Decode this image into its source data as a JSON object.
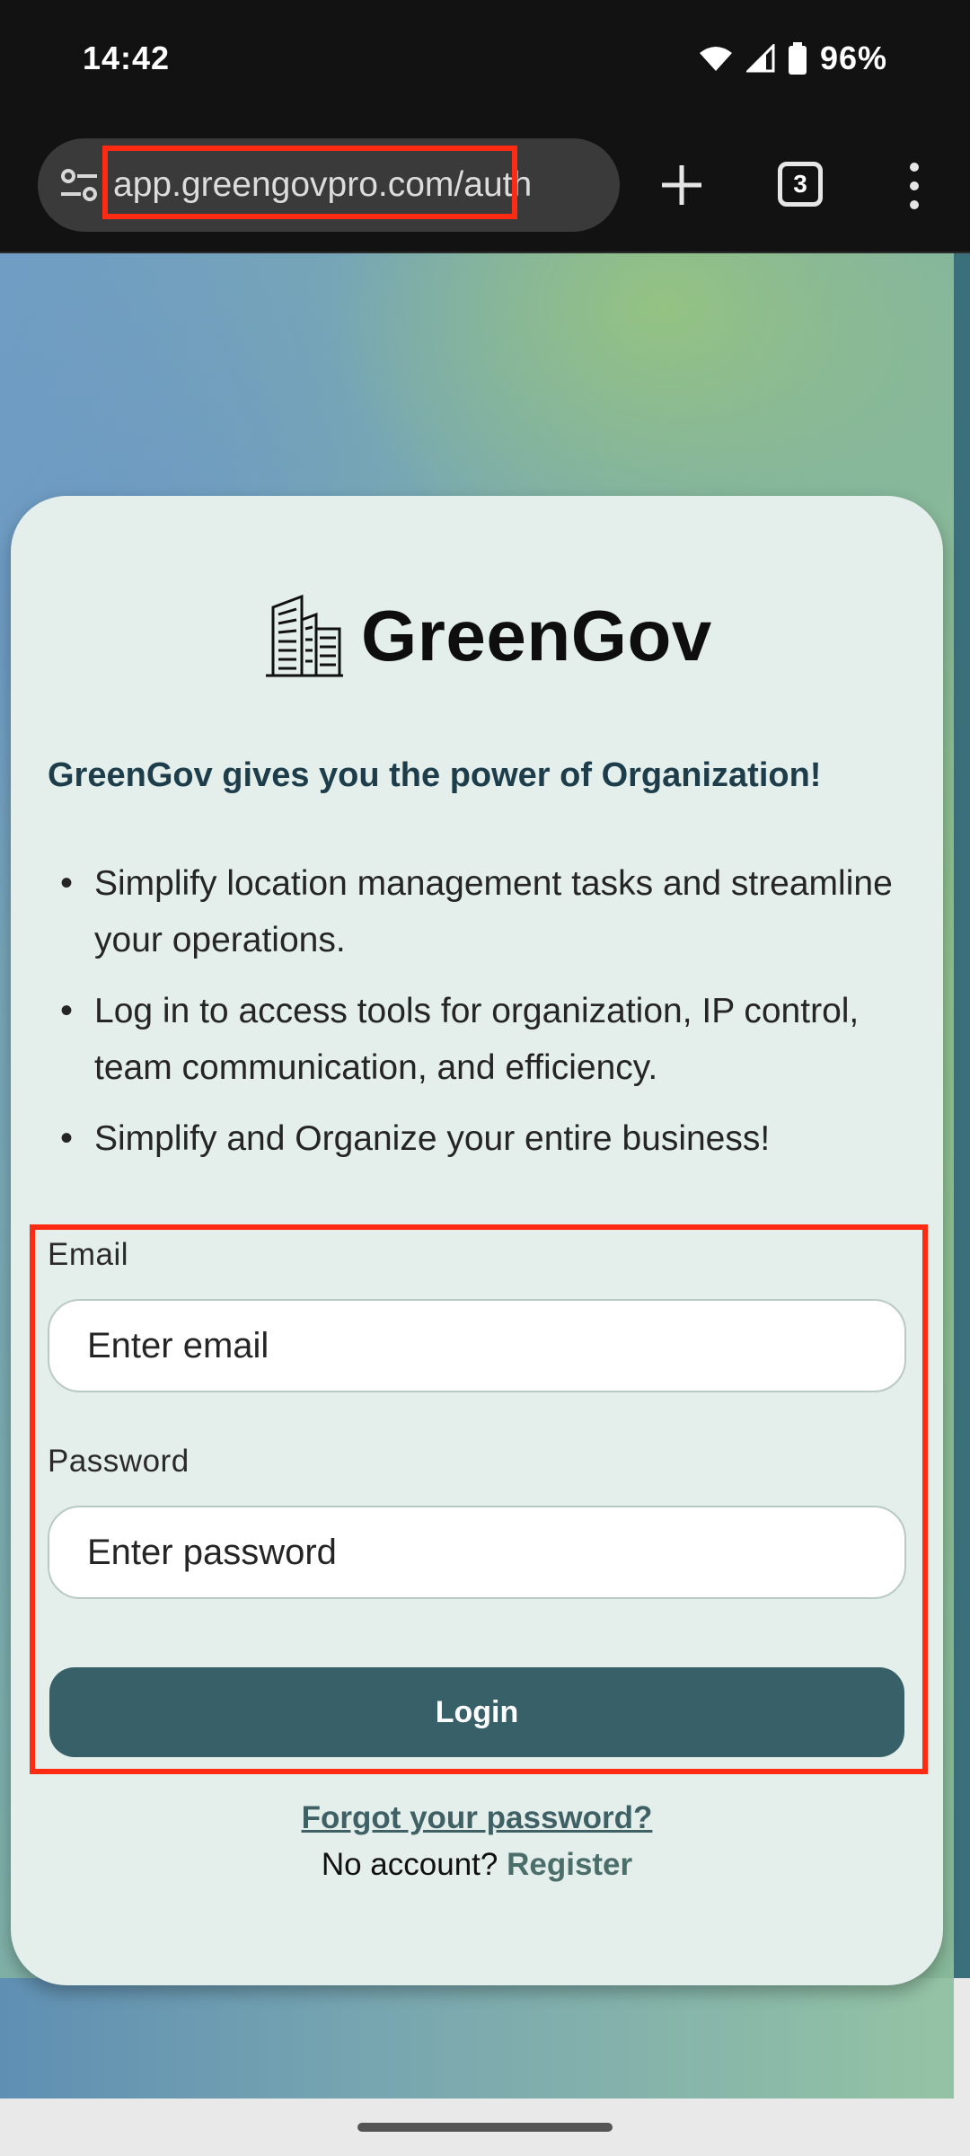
{
  "status_bar": {
    "time": "14:42",
    "battery": "96%",
    "icons": [
      "wifi-icon",
      "signal-icon",
      "battery-icon"
    ]
  },
  "browser": {
    "url": "app.greengovpro.com/auth",
    "tab_count": "3",
    "icons": [
      "site-settings-icon",
      "plus-icon",
      "tabs-icon",
      "more-vert-icon"
    ]
  },
  "card": {
    "logo_text": "GreenGov",
    "logo_icon": "buildings-icon",
    "tagline": "GreenGov gives you the power of Organization!",
    "features": [
      "Simplify location management tasks and streamline your operations.",
      "Log in to access tools for organization, IP control, team communication, and efficiency.",
      "Simplify and Organize your entire business!"
    ]
  },
  "form": {
    "email_label": "Email",
    "email_placeholder": "Enter email",
    "email_value": "",
    "password_label": "Password",
    "password_placeholder": "Enter password",
    "password_value": "",
    "login_label": "Login",
    "forgot_link": "Forgot your password?",
    "no_account_text": "No account?",
    "register_link": "Register"
  },
  "colors": {
    "primary": "#376069",
    "card_background": "#e4efec",
    "tagline": "#1d3d4a",
    "highlight": "#ff2a12"
  }
}
